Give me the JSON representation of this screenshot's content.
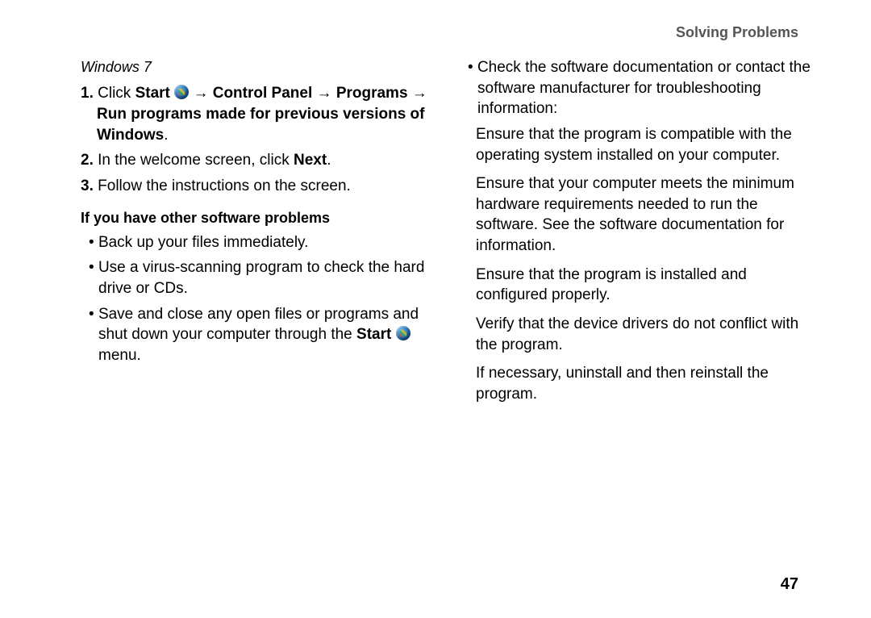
{
  "header": {
    "title": "Solving Problems"
  },
  "left": {
    "os_label": "Windows 7",
    "step1": {
      "num": "1.",
      "t1": "Click",
      "t2": "Start",
      "t3": "→",
      "t4": "Control Panel",
      "t5": "→",
      "t6": "Programs",
      "t7": "→",
      "t8": "Run programs made for previous versions of Windows",
      "t9": "."
    },
    "step2": {
      "num": "2.",
      "t1": "In the welcome screen, click",
      "t2": "Next",
      "t3": "."
    },
    "step3": {
      "num": "3.",
      "t1": "Follow the instructions on the screen."
    },
    "subheading": "If you have other software problems",
    "b1": "Back up your files immediately.",
    "b2": "Use a virus-scanning program to check the hard drive or CDs.",
    "b3_a": "Save and close any open files or programs and shut down your computer through the ",
    "b3_b": "Start",
    "b3_c": " menu."
  },
  "right": {
    "b1": "Check the software documentation or contact the software manufacturer for troubleshooting information:",
    "s1": "Ensure that the program is compatible with the operating system installed on your computer.",
    "s2": "Ensure that your computer meets the minimum hardware requirements needed to run the software. See the software documentation for information.",
    "s3": "Ensure that the program is installed and configured properly.",
    "s4": "Verify that the device drivers do not conflict with the program.",
    "s5": "If necessary, uninstall and then reinstall the program."
  },
  "page_number": "47"
}
